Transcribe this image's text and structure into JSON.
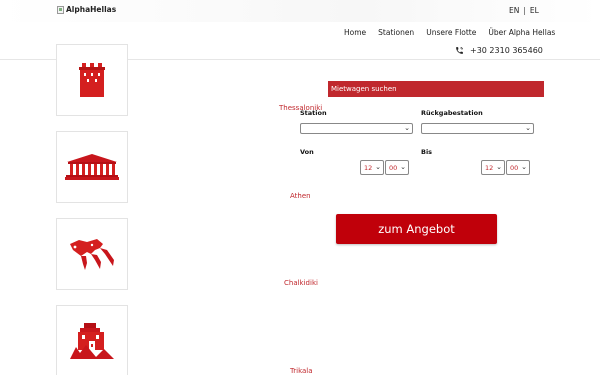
{
  "header": {
    "logo_alt": "AlphaHellas",
    "languages": [
      "EN",
      "EL"
    ],
    "separator": "|",
    "nav": [
      "Home",
      "Stationen",
      "Unsere Flotte",
      "Über Alpha Hellas"
    ],
    "phone": "+30 2310 365460"
  },
  "stations": [
    {
      "label": "Thessaloniki",
      "icon": "white-tower-icon"
    },
    {
      "label": "Athen",
      "icon": "parthenon-icon"
    },
    {
      "label": "Chalkidiki",
      "icon": "chalkidiki-map-icon"
    },
    {
      "label": "Trikala",
      "icon": "trikala-landmark-icon"
    }
  ],
  "search": {
    "title": "Mietwagen suchen",
    "station_label": "Station",
    "return_label": "Rückgabestation",
    "station_value": "",
    "return_value": "",
    "from_label": "Von",
    "to_label": "Bis",
    "from_hour": "12",
    "from_minute": "00",
    "to_hour": "12",
    "to_minute": "00",
    "submit": "zum Angebot"
  },
  "colors": {
    "accent": "#c0282d",
    "button": "#c0000a"
  }
}
